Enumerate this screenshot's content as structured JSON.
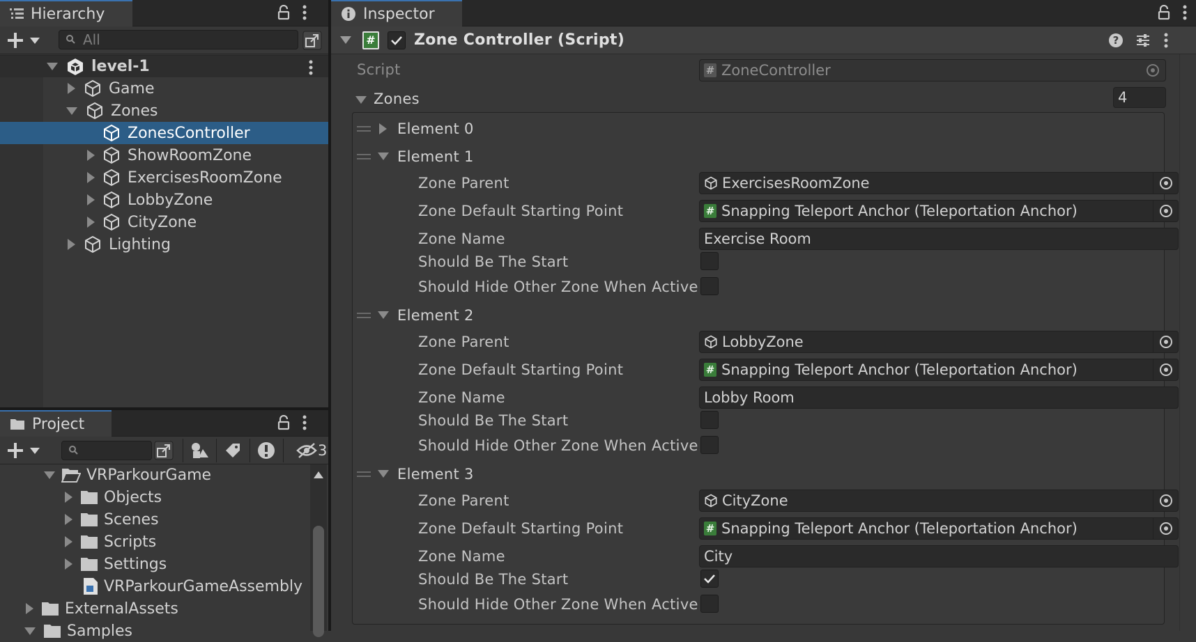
{
  "hierarchy": {
    "tab_title": "Hierarchy",
    "search_placeholder": "All",
    "scene": "level-1",
    "items": [
      {
        "label": "Game"
      },
      {
        "label": "Zones"
      },
      {
        "label": "ZonesController"
      },
      {
        "label": "ShowRoomZone"
      },
      {
        "label": "ExercisesRoomZone"
      },
      {
        "label": "LobbyZone"
      },
      {
        "label": "CityZone"
      },
      {
        "label": "Lighting"
      }
    ]
  },
  "project": {
    "tab_title": "Project",
    "hidden_count": "3",
    "items": [
      {
        "label": "VRParkourGame"
      },
      {
        "label": "Objects"
      },
      {
        "label": "Scenes"
      },
      {
        "label": "Scripts"
      },
      {
        "label": "Settings"
      },
      {
        "label": "VRParkourGameAssembly"
      },
      {
        "label": "ExternalAssets"
      },
      {
        "label": "Samples"
      }
    ]
  },
  "inspector": {
    "tab_title": "Inspector",
    "component_title": "Zone Controller (Script)",
    "script_label": "Script",
    "script_value": "ZoneController",
    "zones_label": "Zones",
    "zones_count": "4",
    "element0": "Element 0",
    "labels": {
      "zone_parent": "Zone Parent",
      "zone_default_start": "Zone Default Starting Point",
      "zone_name": "Zone Name",
      "should_be_start": "Should Be The Start",
      "should_hide": "Should Hide Other Zone When Active"
    },
    "elements": [
      {
        "title": "Element 1",
        "zone_parent": "ExercisesRoomZone",
        "starting_point": "Snapping Teleport Anchor (Teleportation Anchor)",
        "zone_name": "Exercise Room",
        "should_be_start": false,
        "should_hide": false
      },
      {
        "title": "Element 2",
        "zone_parent": "LobbyZone",
        "starting_point": "Snapping Teleport Anchor (Teleportation Anchor)",
        "zone_name": "Lobby Room",
        "should_be_start": false,
        "should_hide": false
      },
      {
        "title": "Element 3",
        "zone_parent": "CityZone",
        "starting_point": "Snapping Teleport Anchor (Teleportation Anchor)",
        "zone_name": "City",
        "should_be_start": true,
        "should_hide": false
      }
    ]
  },
  "colors": {
    "selection": "#2c5d87",
    "tab_accent": "#3a72b0",
    "script_icon": "#3a7d3a"
  }
}
